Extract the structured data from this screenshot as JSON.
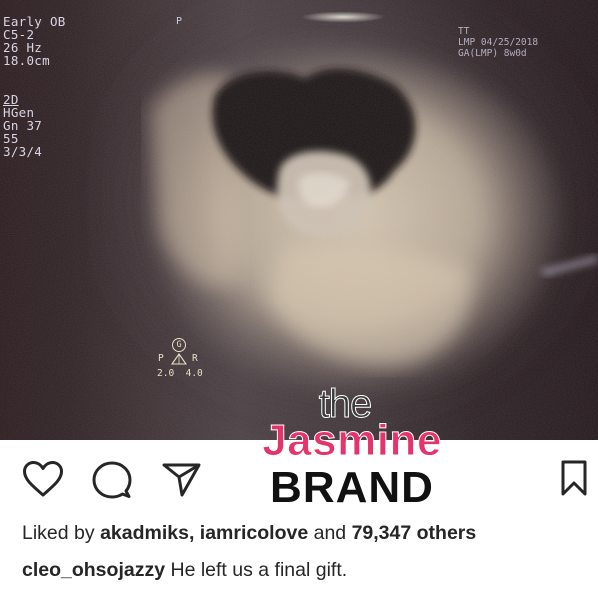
{
  "scan": {
    "readout_lines": [
      "Early OB",
      "C5-2",
      "26 Hz",
      "18.0cm"
    ],
    "mode_label": "2D",
    "mode_lines": [
      "HGen",
      "Gn 37",
      "55",
      "3/3/4"
    ],
    "top_marker": "P",
    "top_right_lines": [
      "TT",
      "LMP 04/25/2018",
      "GA(LMP) 8w0d"
    ],
    "orientation": {
      "g": "G",
      "left": "P",
      "right": "R",
      "scale": "2.0  4.0"
    }
  },
  "watermark": {
    "the": "the",
    "jasmine": "Jasmine",
    "brand": "BRAND"
  },
  "icons": {
    "like": "heart-outline",
    "comment": "speech-bubble-outline",
    "share": "paper-plane-outline",
    "save": "bookmark-outline"
  },
  "post": {
    "liked_prefix": "Liked by",
    "liked_users": "akadmiks, iamricolove",
    "liked_and": "and",
    "liked_count": "79,347 others",
    "username": "cleo_ohsojazzy",
    "caption_text": "He left us a final gift."
  },
  "colors": {
    "brand_pink": "#e6336b",
    "text": "#262626"
  }
}
